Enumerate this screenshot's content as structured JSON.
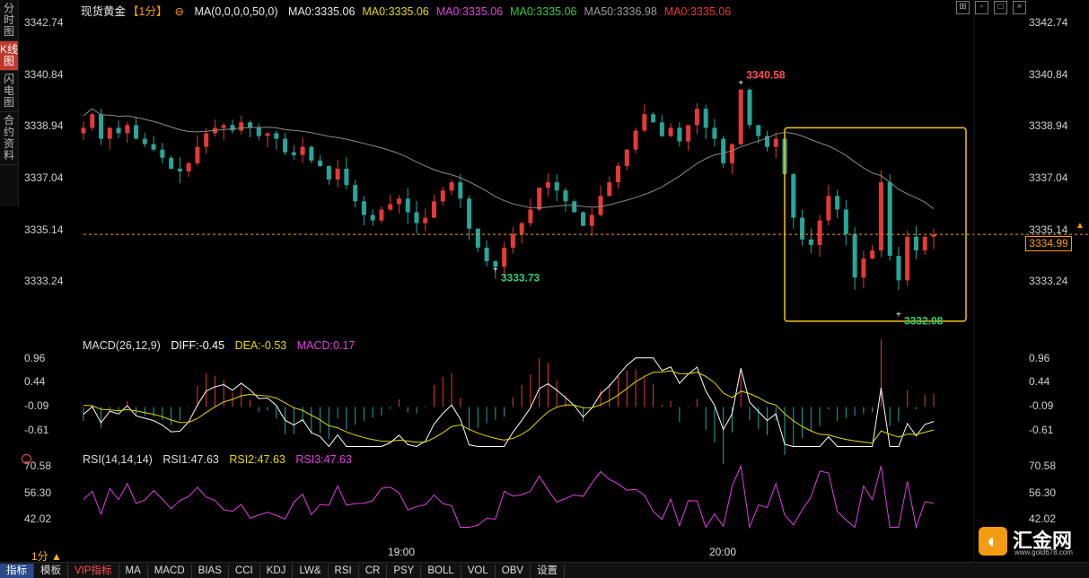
{
  "sidebar": {
    "tabs": [
      "分时图",
      "K线图",
      "闪电图",
      "合约资料"
    ],
    "active": 1
  },
  "header": {
    "symbol": "现货黄金",
    "period": "【1分】",
    "ma_params": "MA(0,0,0,0,50,0)",
    "ma_items": [
      {
        "label": "MA0:3335.06",
        "color": "#e8e8e8"
      },
      {
        "label": "MA0:3335.06",
        "color": "#e6d800"
      },
      {
        "label": "MA0:3335.06",
        "color": "#e040e0"
      },
      {
        "label": "MA0:3335.06",
        "color": "#2ecc40"
      },
      {
        "label": "MA50:3336.98",
        "color": "#9a9a9a"
      },
      {
        "label": "MA0:3335.06",
        "color": "#e53935"
      }
    ]
  },
  "price_axis": {
    "ticks": [
      "3342.74",
      "3340.84",
      "3338.94",
      "3337.04",
      "3335.14",
      "3333.24"
    ],
    "last_price": "3334.99",
    "ylim": [
      3331.4,
      3343.1
    ]
  },
  "annotations": {
    "high": "3340.58",
    "low": "3333.73",
    "low2": "3332.08"
  },
  "macd": {
    "title": "MACD(26,12,9)",
    "diff": "DIFF:-0.45",
    "dea": "DEA:-0.53",
    "macd": "MACD:0.17",
    "ticks": [
      "0.96",
      "0.44",
      "-0.09",
      "-0.61"
    ],
    "ylim": [
      -1.0,
      1.15
    ]
  },
  "rsi": {
    "title": "RSI(14,14,14)",
    "rsi1": "RSI1:47.63",
    "rsi2": "RSI2:47.63",
    "rsi3": "RSI3:47.63",
    "ticks": [
      "70.58",
      "56.30",
      "42.02"
    ],
    "ylim": [
      32,
      73
    ]
  },
  "x_axis": {
    "labels": [
      "19:00",
      "20:00"
    ]
  },
  "period_label": "1分 ▲",
  "bottom_tabs": [
    "指标",
    "模板",
    "VIP指标",
    "MA",
    "MACD",
    "BIAS",
    "CCI",
    "KDJ",
    "LW&",
    "RSI",
    "CR",
    "PSY",
    "BOLL",
    "VOL",
    "OBV",
    "设置"
  ],
  "logo": {
    "mark": "◐",
    "name": "汇金网",
    "url": "www.gold678.com"
  },
  "colors": {
    "up": "#e53935",
    "down": "#26a69a",
    "ma50": "#8a8a8a",
    "diff": "#ffffff",
    "dea": "#e6d800",
    "rsi": "#e040e0",
    "highlight": "#f1c40f"
  },
  "chart_data": {
    "type": "candlestick",
    "x": [
      "19:00",
      "20:00"
    ],
    "ohlc_close": [
      3338.9,
      3339.4,
      3338.5,
      3338.9,
      3338.7,
      3339.0,
      3338.5,
      3338.3,
      3338.1,
      3337.8,
      3337.4,
      3337.3,
      3337.6,
      3338.2,
      3338.7,
      3338.9,
      3339.0,
      3338.8,
      3339.1,
      3338.9,
      3338.6,
      3338.7,
      3338.5,
      3338.0,
      3337.9,
      3338.2,
      3337.7,
      3337.5,
      3337.0,
      3337.4,
      3336.8,
      3336.2,
      3335.7,
      3335.5,
      3335.9,
      3336.1,
      3336.3,
      3335.8,
      3335.4,
      3335.6,
      3336.2,
      3336.6,
      3336.9,
      3336.3,
      3335.2,
      3334.5,
      3334.0,
      3333.8,
      3334.5,
      3335.0,
      3335.4,
      3335.9,
      3336.7,
      3336.9,
      3336.6,
      3336.2,
      3335.8,
      3335.3,
      3335.7,
      3336.4,
      3336.9,
      3337.5,
      3338.1,
      3338.8,
      3339.4,
      3339.1,
      3338.6,
      3338.9,
      3338.4,
      3339.0,
      3339.6,
      3338.9,
      3338.5,
      3337.6,
      3338.3,
      3340.3,
      3339.0,
      3338.6,
      3338.2,
      3338.5,
      3337.2,
      3335.6,
      3334.8,
      3334.6,
      3335.5,
      3336.4,
      3335.9,
      3335.0,
      3333.4,
      3334.1,
      3334.4,
      3336.9,
      3334.2,
      3333.3,
      3334.9,
      3334.4,
      3334.9,
      3334.99
    ],
    "macd_hist_note": "histogram shown as bars",
    "rsi_range": [
      38,
      71
    ]
  }
}
